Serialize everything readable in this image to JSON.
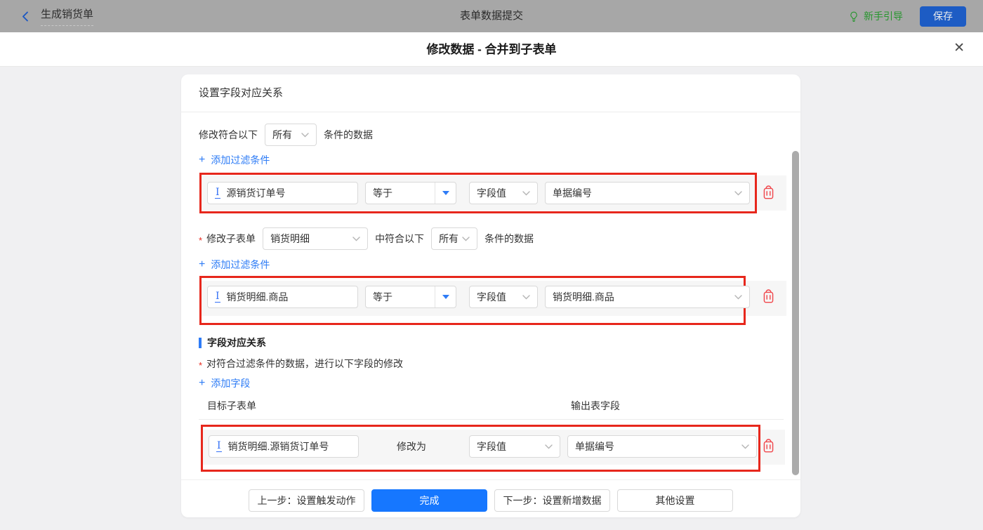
{
  "icons": {
    "plus": "+",
    "close": "✕",
    "asterisk": "*",
    "text_field_glyph": "I"
  },
  "topbar": {
    "back_label": "生成销货单",
    "title": "表单数据提交",
    "guide_label": "新手引导",
    "save_label": "保存"
  },
  "dialog": {
    "title": "修改数据 - 合并到子表单"
  },
  "panel": {
    "title": "设置字段对应关系",
    "cond1": {
      "before": "修改符合以下",
      "match": "所有",
      "after": "条件的数据",
      "add_filter": "添加过滤条件",
      "row": {
        "field": "源销货订单号",
        "operator": "等于",
        "value_type": "字段值",
        "value": "单据编号"
      }
    },
    "cond2": {
      "label": "修改子表单",
      "subform": "销货明细",
      "middle": "中符合以下",
      "match": "所有",
      "after": "条件的数据",
      "add_filter": "添加过滤条件",
      "row": {
        "field": "销货明细.商品",
        "operator": "等于",
        "value_type": "字段值",
        "value": "销货明细.商品"
      }
    },
    "mapping": {
      "title": "字段对应关系",
      "desc": "对符合过滤条件的数据，进行以下字段的修改",
      "add_field": "添加字段",
      "col_target": "目标子表单",
      "col_output": "输出表字段",
      "row": {
        "field": "销货明细.源销货订单号",
        "action": "修改为",
        "value_type": "字段值",
        "value": "单据编号"
      }
    },
    "footer": {
      "prev": "上一步：设置触发动作",
      "done": "完成",
      "next": "下一步：设置新增数据",
      "other": "其他设置"
    }
  },
  "colors": {
    "primary_blue": "#1677ff",
    "link_blue": "#2e7cf6",
    "highlight_red": "#e7271c",
    "danger_red": "#f0464b",
    "guide_green": "#27962e",
    "topbar_dimmed": "#a7a7a7"
  }
}
